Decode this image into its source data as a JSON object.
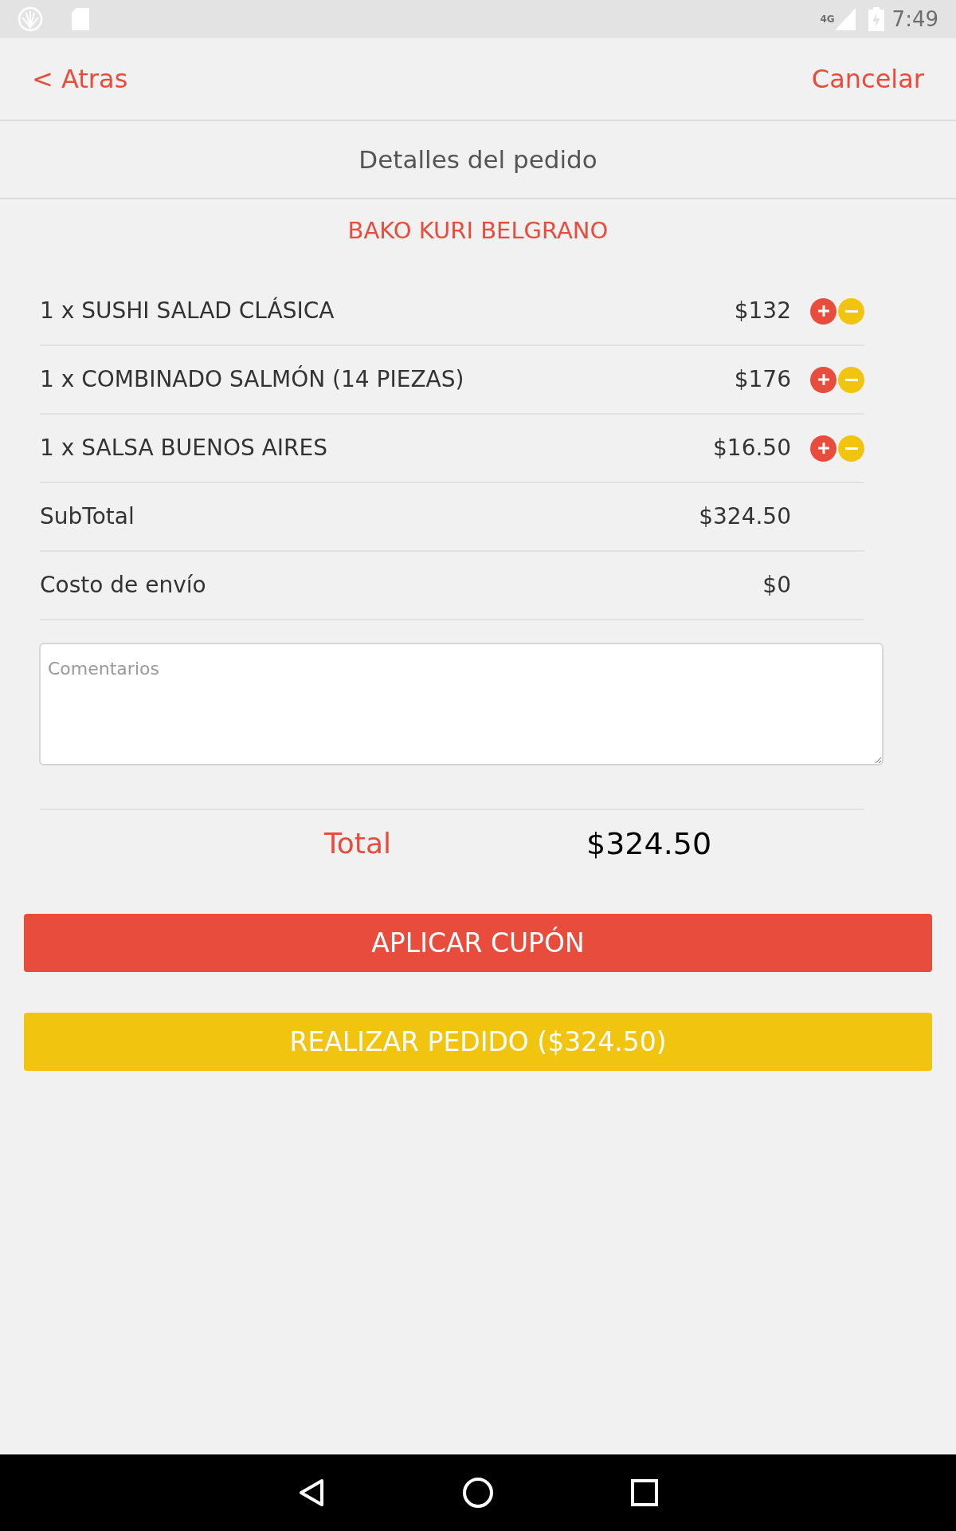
{
  "status_bar": {
    "network": "4G",
    "time": "7:49"
  },
  "nav": {
    "back": "< Atras",
    "cancel": "Cancelar"
  },
  "title": "Detalles del pedido",
  "restaurant": "BAKO KURI BELGRANO",
  "items": [
    {
      "label": "1 x SUSHI SALAD CLÁSICA",
      "price": "$132"
    },
    {
      "label": "1 x COMBINADO SALMÓN (14 PIEZAS)",
      "price": "$176"
    },
    {
      "label": "1 x SALSA BUENOS AIRES",
      "price": "$16.50"
    }
  ],
  "summary": [
    {
      "label": "SubTotal",
      "value": "$324.50"
    },
    {
      "label": "Costo de envío",
      "value": "$0"
    }
  ],
  "comments": {
    "placeholder": "Comentarios"
  },
  "total": {
    "label": "Total",
    "value": "$324.50"
  },
  "buttons": [
    {
      "kind": "coupon",
      "label": "APLICAR CUPÓN"
    },
    {
      "kind": "order",
      "label": "REALIZAR PEDIDO ($324.50)"
    }
  ]
}
